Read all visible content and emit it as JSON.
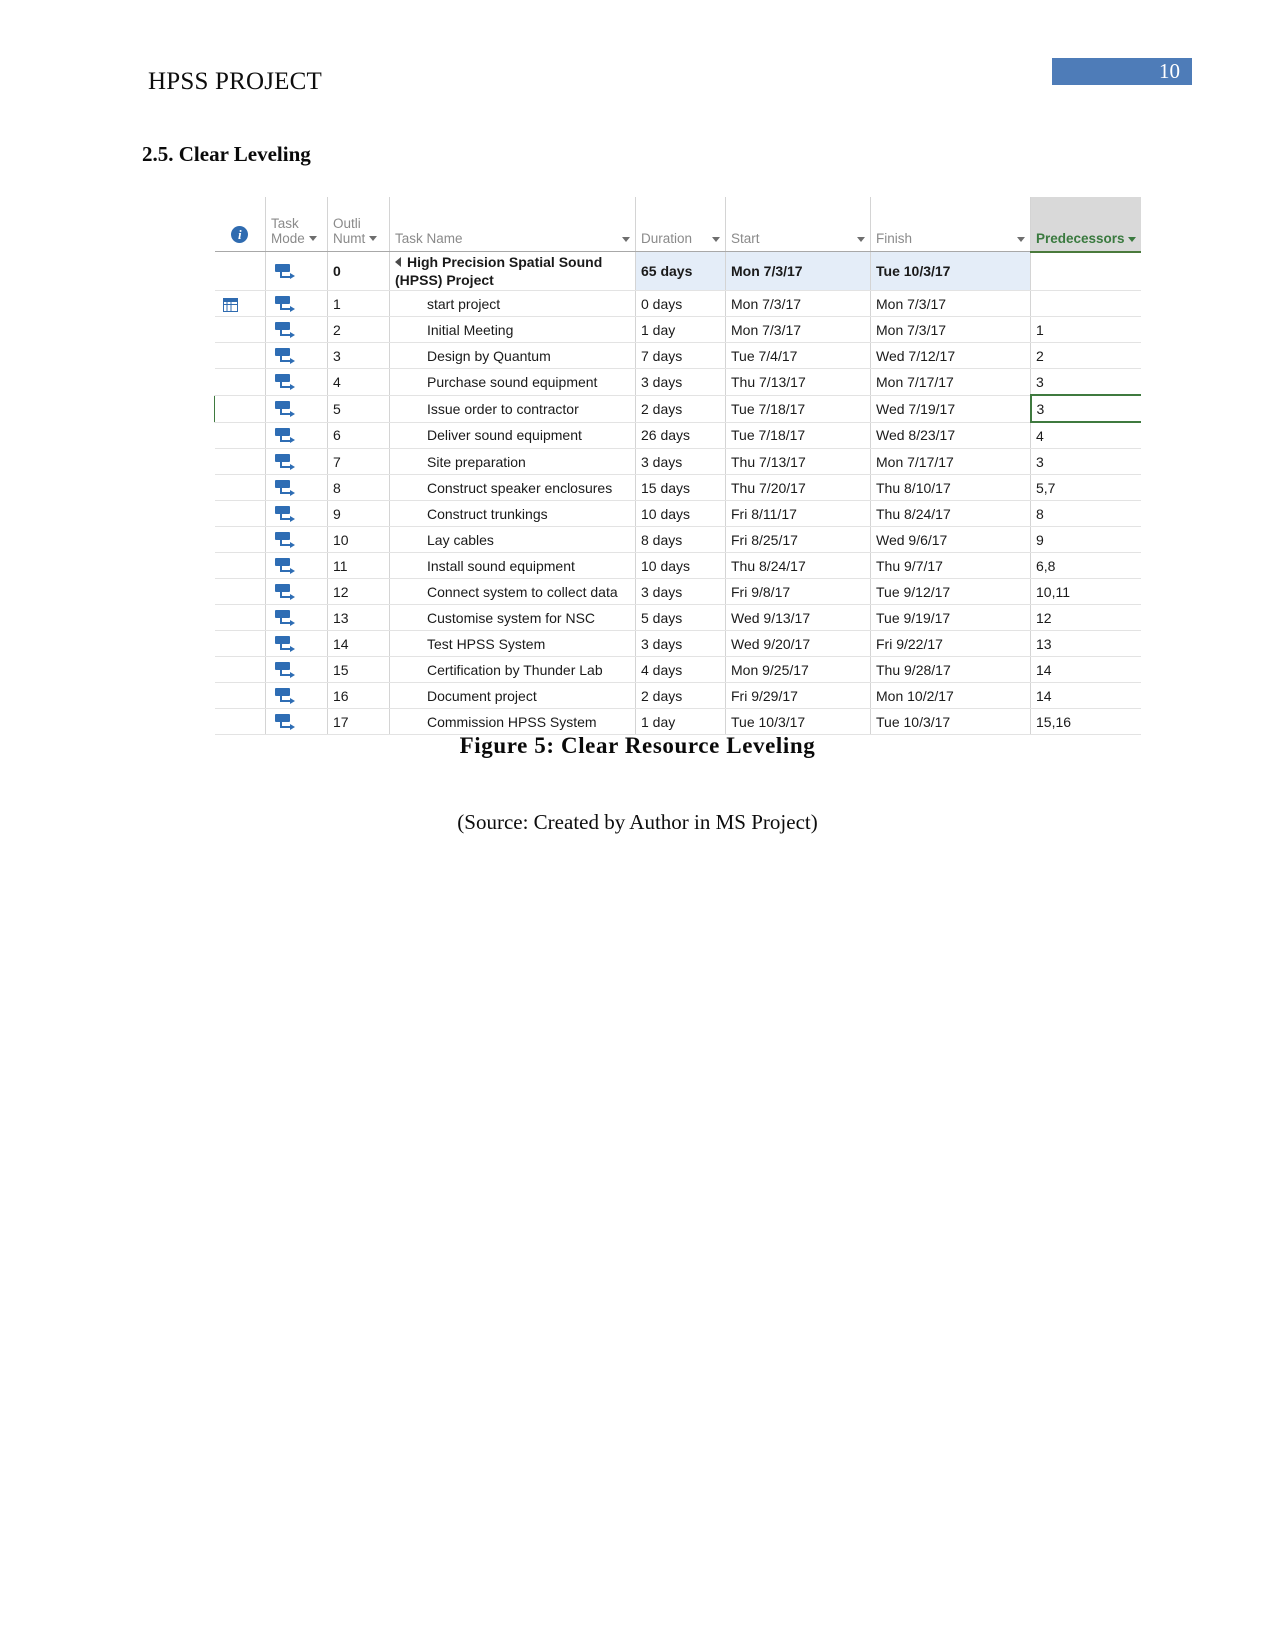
{
  "header": {
    "doc_title": "HPSS PROJECT",
    "page_number": "10",
    "badge_color": "#4e7cb8"
  },
  "section": {
    "heading": "2.5. Clear Leveling"
  },
  "figure": {
    "caption": "Figure 5: Clear Resource Leveling",
    "source": "(Source: Created by Author in MS Project)"
  },
  "table": {
    "columns": [
      {
        "key": "info",
        "label": "",
        "icon": "info-icon",
        "filter": false
      },
      {
        "key": "mode",
        "label": "Task Mode",
        "line1": "Task",
        "line2": "Mode",
        "filter": true
      },
      {
        "key": "outline",
        "label": "Outli Numt",
        "line1": "Outli",
        "line2": "Numt",
        "filter": true
      },
      {
        "key": "name",
        "label": "Task Name",
        "filter": true
      },
      {
        "key": "duration",
        "label": "Duration",
        "filter": true
      },
      {
        "key": "start",
        "label": "Start",
        "filter": true
      },
      {
        "key": "finish",
        "label": "Finish",
        "filter": true
      },
      {
        "key": "pred",
        "label": "Predecessors",
        "filter": true,
        "selected": true
      }
    ],
    "header_colors": {
      "text": "#8a8a8a",
      "selected_bg": "#d9d9d9",
      "selected_text": "#3a7a3f",
      "selected_underline": "#4a7a3c"
    },
    "highlight_color": "#e4edf8",
    "selection_border": "#3f7a3f",
    "rows": [
      {
        "summary": true,
        "info": "",
        "outline": "0",
        "name": "High Precision Spatial Sound (HPSS) Project",
        "duration": "65 days",
        "start": "Mon 7/3/17",
        "finish": "Tue 10/3/17",
        "pred": "",
        "hl": [
          "duration",
          "start",
          "finish"
        ]
      },
      {
        "info": "calendar-icon",
        "outline": "1",
        "name": "start project",
        "duration": "0 days",
        "start": "Mon 7/3/17",
        "finish": "Mon 7/3/17",
        "pred": "",
        "hl": []
      },
      {
        "info": "",
        "outline": "2",
        "name": "Initial Meeting",
        "duration": "1 day",
        "start": "Mon 7/3/17",
        "finish": "Mon 7/3/17",
        "pred": "1",
        "hl": []
      },
      {
        "info": "",
        "outline": "3",
        "name": "Design by Quantum",
        "duration": "7 days",
        "start": "Tue 7/4/17",
        "finish": "Wed 7/12/17",
        "pred": "2",
        "hl": []
      },
      {
        "info": "",
        "outline": "4",
        "name": "Purchase sound equipment",
        "duration": "3 days",
        "start": "Thu 7/13/17",
        "finish": "Mon 7/17/17",
        "pred": "3",
        "hl": []
      },
      {
        "selected": true,
        "info": "",
        "outline": "5",
        "name": "Issue order to contractor",
        "duration": "2 days",
        "start": "Tue 7/18/17",
        "finish": "Wed 7/19/17",
        "pred": "3",
        "hl": []
      },
      {
        "info": "",
        "outline": "6",
        "name": "Deliver sound equipment",
        "duration": "26 days",
        "start": "Tue 7/18/17",
        "finish": "Wed 8/23/17",
        "pred": "4",
        "hl": []
      },
      {
        "info": "",
        "outline": "7",
        "name": "Site preparation",
        "duration": "3 days",
        "start": "Thu 7/13/17",
        "finish": "Mon 7/17/17",
        "pred": "3",
        "hl": []
      },
      {
        "info": "",
        "outline": "8",
        "name": "Construct speaker enclosures",
        "duration": "15 days",
        "start": "Thu 7/20/17",
        "finish": "Thu 8/10/17",
        "pred": "5,7",
        "hl": [
          "start",
          "finish"
        ]
      },
      {
        "info": "",
        "outline": "9",
        "name": "Construct trunkings",
        "duration": "10 days",
        "start": "Fri 8/11/17",
        "finish": "Thu 8/24/17",
        "pred": "8",
        "hl": [
          "start",
          "finish"
        ]
      },
      {
        "info": "",
        "outline": "10",
        "name": "Lay cables",
        "duration": "8 days",
        "start": "Fri 8/25/17",
        "finish": "Wed 9/6/17",
        "pred": "9",
        "hl": [
          "start",
          "finish"
        ]
      },
      {
        "info": "",
        "outline": "11",
        "name": "Install sound equipment",
        "duration": "10 days",
        "start": "Thu 8/24/17",
        "finish": "Thu 9/7/17",
        "pred": "6,8",
        "hl": []
      },
      {
        "info": "",
        "outline": "12",
        "name": "Connect system to collect data",
        "duration": "3 days",
        "start": "Fri 9/8/17",
        "finish": "Tue 9/12/17",
        "pred": "10,11",
        "hl": []
      },
      {
        "info": "",
        "outline": "13",
        "name": "Customise system for NSC",
        "duration": "5 days",
        "start": "Wed 9/13/17",
        "finish": "Tue 9/19/17",
        "pred": "12",
        "hl": []
      },
      {
        "info": "",
        "outline": "14",
        "name": "Test HPSS System",
        "duration": "3 days",
        "start": "Wed 9/20/17",
        "finish": "Fri 9/22/17",
        "pred": "13",
        "hl": []
      },
      {
        "info": "",
        "outline": "15",
        "name": "Certification by Thunder Lab",
        "duration": "4 days",
        "start": "Mon 9/25/17",
        "finish": "Thu 9/28/17",
        "pred": "14",
        "hl": []
      },
      {
        "info": "",
        "outline": "16",
        "name": "Document project",
        "duration": "2 days",
        "start": "Fri 9/29/17",
        "finish": "Mon 10/2/17",
        "pred": "14",
        "hl": [
          "start",
          "finish"
        ]
      },
      {
        "info": "",
        "outline": "17",
        "name": "Commission HPSS System",
        "duration": "1 day",
        "start": "Tue 10/3/17",
        "finish": "Tue 10/3/17",
        "pred": "15,16",
        "hl": [
          "start",
          "finish"
        ]
      }
    ]
  }
}
